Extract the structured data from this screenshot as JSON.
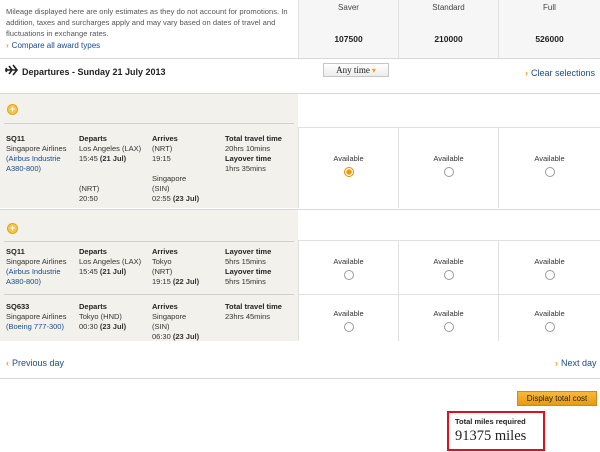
{
  "summary": {
    "disclaimer": "Mileage displayed here are only estimates as they do not account for promotions. In addition, taxes and surcharges apply and may vary based on dates of travel and fluctuations in exchange rates.",
    "compare_link": "Compare all award types",
    "fare_types": [
      {
        "name": "Saver",
        "miles": "107500"
      },
      {
        "name": "Standard",
        "miles": "210000"
      },
      {
        "name": "Full",
        "miles": "526000"
      }
    ]
  },
  "departures": {
    "title": "Departures - Sunday 21 July 2013",
    "time_filter": "Any time",
    "clear_link": "Clear selections"
  },
  "option1": {
    "flight_no": "SQ11",
    "airline": "Singapore Airlines",
    "aircraft": "(Airbus Industrie A380-800)",
    "departs_label": "Departs",
    "dep_city": "Los Angeles (LAX)",
    "dep_time": "15:45",
    "dep_date": "(21 Jul)",
    "stop_code": "(NRT)",
    "stop_dep_time": "20:50",
    "arrives_label": "Arrives",
    "arr1_code": "(NRT)",
    "arr1_time": "19:15",
    "arr2_city": "Singapore",
    "arr2_code": "(SIN)",
    "arr2_time": "02:55",
    "arr2_date": "(23 Jul)",
    "total_label": "Total travel time",
    "total_value": "20hrs 10mins",
    "layover_label": "Layover time",
    "layover_value": "1hrs 35mins",
    "availability": [
      "Available",
      "Available",
      "Available"
    ]
  },
  "option2": {
    "leg1": {
      "flight_no": "SQ11",
      "airline": "Singapore Airlines",
      "aircraft": "(Airbus Industrie A380-800)",
      "departs_label": "Departs",
      "dep_city": "Los Angeles (LAX)",
      "dep_time": "15:45",
      "dep_date": "(21 Jul)",
      "arrives_label": "Arrives",
      "arr_city": "Tokyo",
      "arr_code": "(NRT)",
      "arr_time": "19:15",
      "arr_date": "(22 Jul)",
      "layover_label": "Layover time",
      "layover_value": "5hrs 15mins",
      "layover_label2": "Layover time",
      "layover_value2": "5hrs 15mins"
    },
    "leg2": {
      "flight_no": "SQ633",
      "airline": "Singapore Airlines",
      "aircraft": "(Boeing 777-300)",
      "departs_label": "Departs",
      "dep_city": "Tokyo (HND)",
      "dep_time": "00:30",
      "dep_date": "(23 Jul)",
      "arrives_label": "Arrives",
      "arr_city": "Singapore",
      "arr_code": "(SIN)",
      "arr_time": "06:30",
      "arr_date": "(23 Jul)",
      "total_label": "Total travel time",
      "total_value": "23hrs 45mins"
    },
    "availability_row1": [
      "Available",
      "Available",
      "Available"
    ],
    "availability_row2": [
      "Available",
      "Available",
      "Available"
    ]
  },
  "footer": {
    "previous_day": "Previous day",
    "next_day": "Next day",
    "display_total_cost": "Display total cost",
    "total_miles_label": "Total miles required",
    "total_miles_value": "91375 miles"
  },
  "colors": {
    "accent": "#e8a317",
    "link": "#1a4b8f",
    "highlight_border": "#e0101a",
    "panel": "#f2f1ec"
  }
}
